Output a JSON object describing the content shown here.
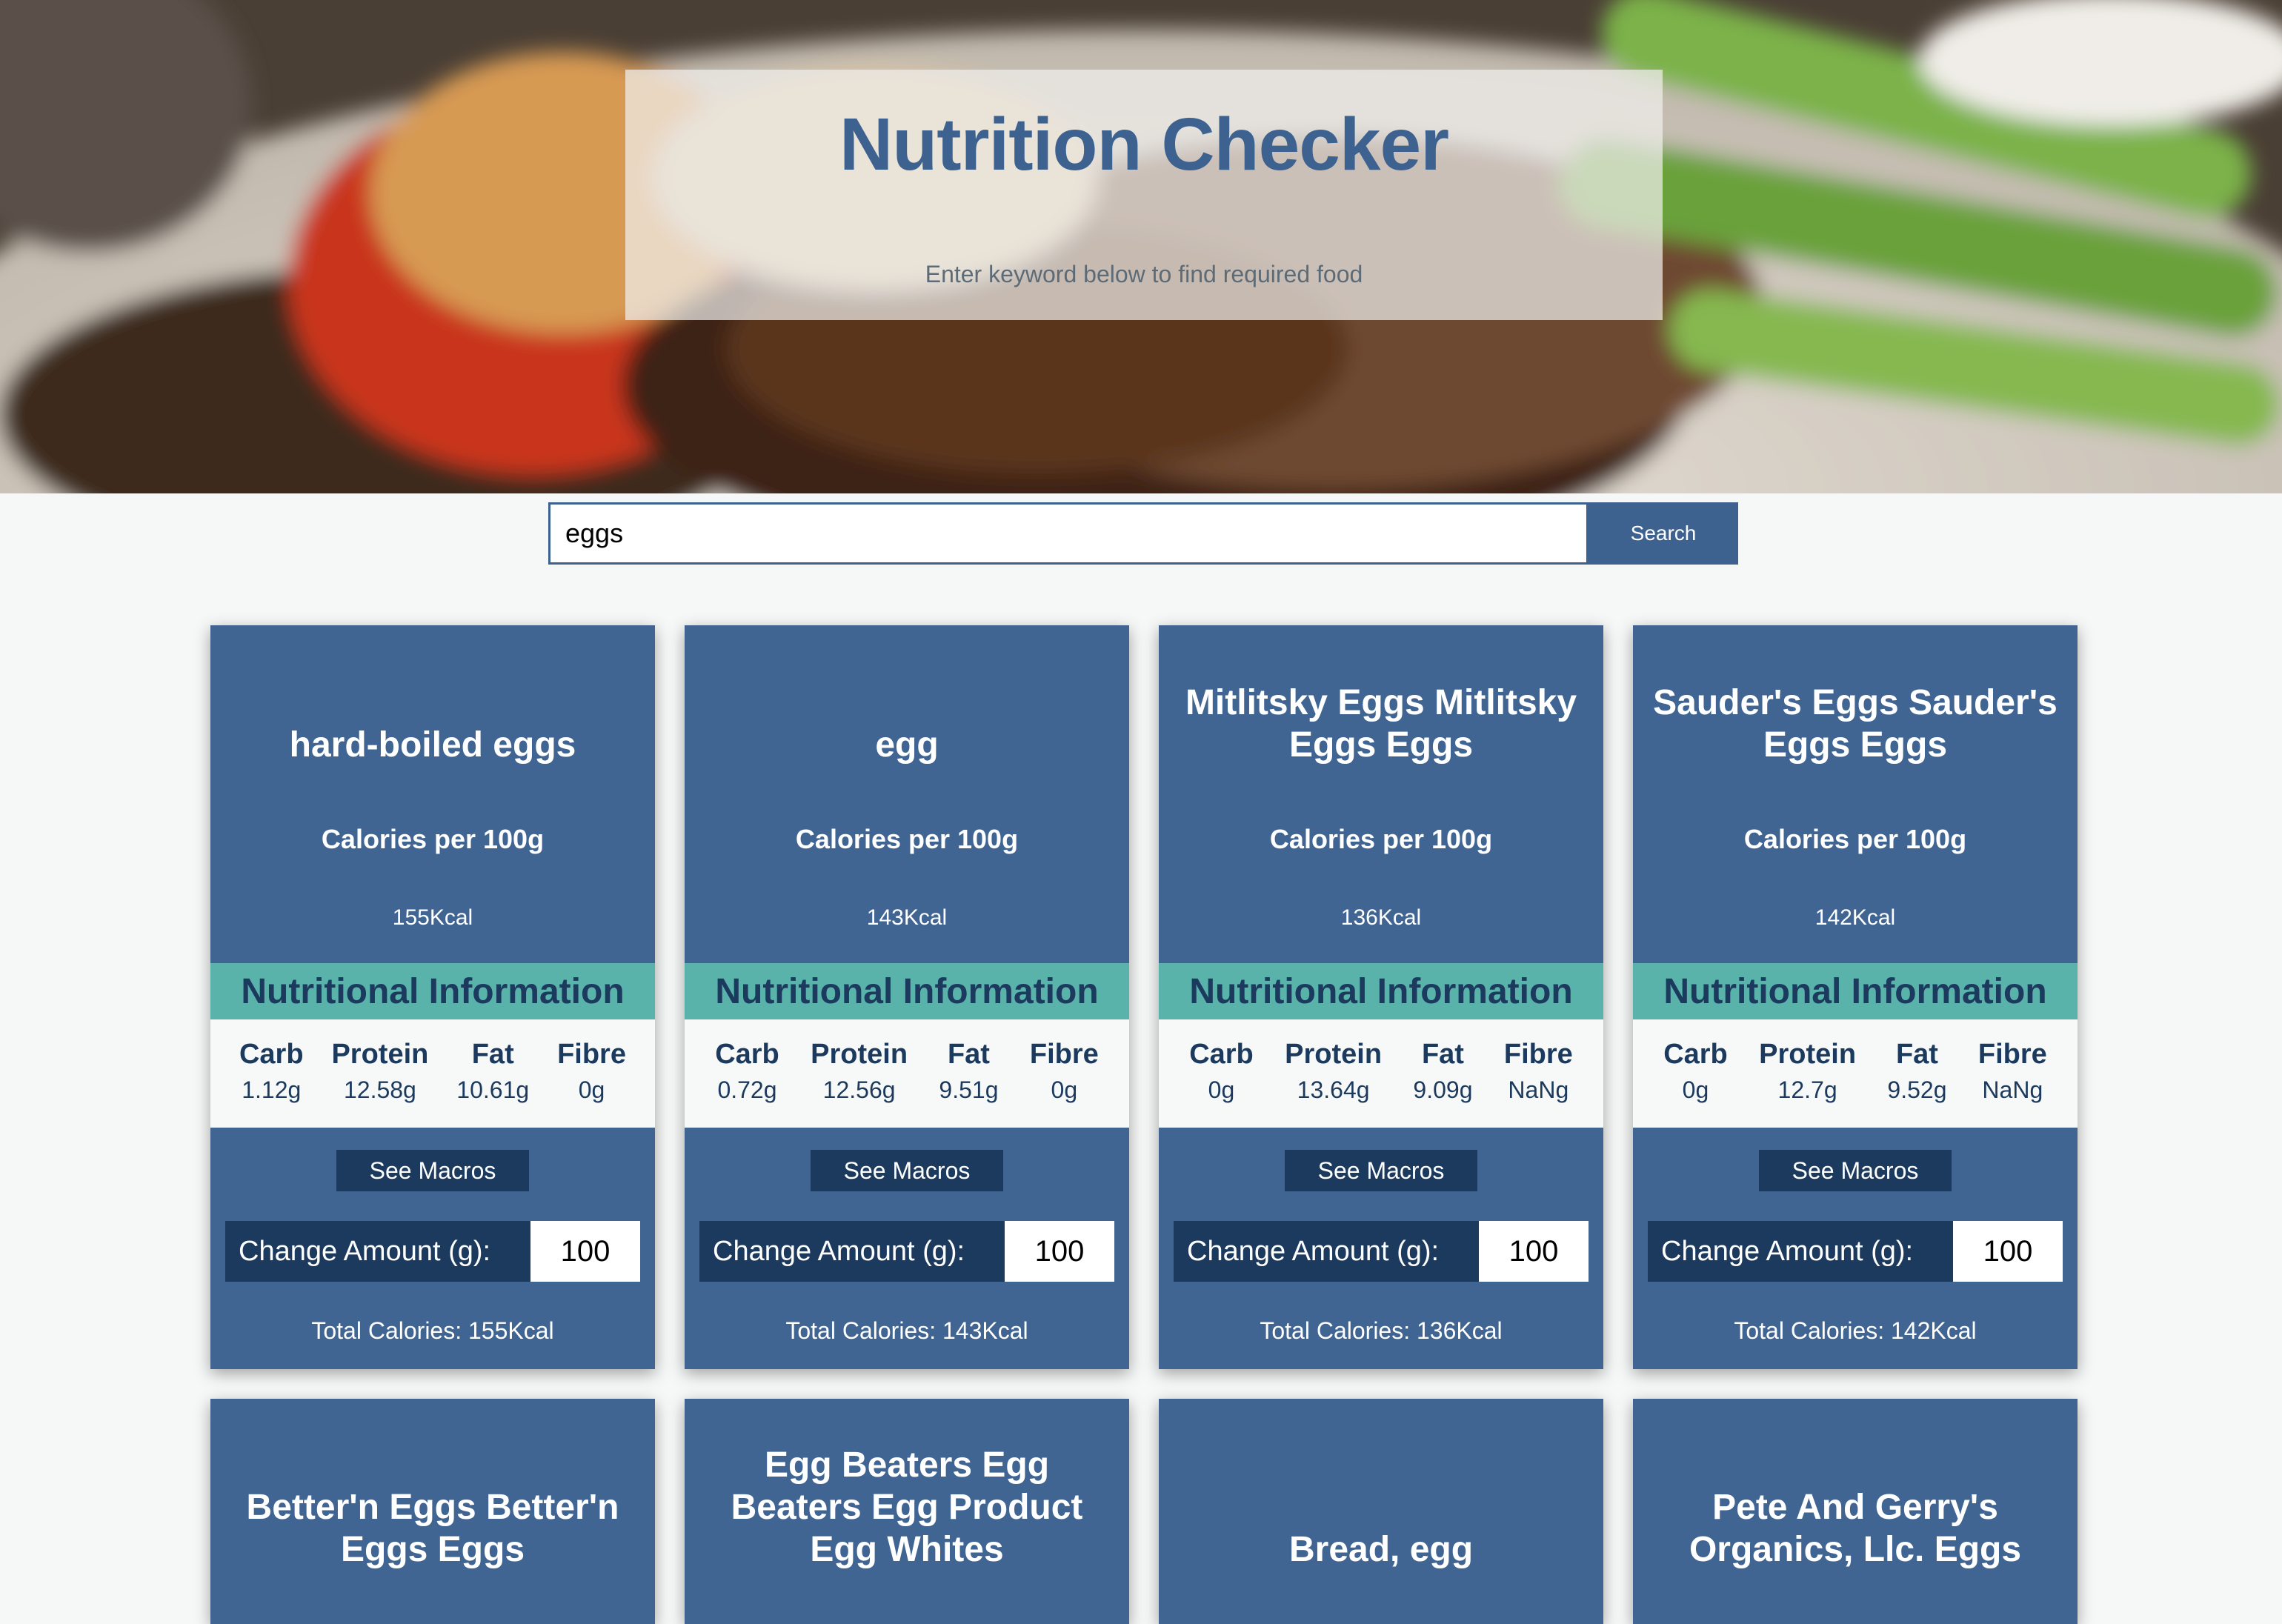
{
  "header": {
    "title": "Nutrition Checker",
    "subtitle": "Enter keyword below to find required food"
  },
  "search": {
    "value": "eggs",
    "button_label": "Search"
  },
  "labels": {
    "calories_per": "Calories per 100g",
    "nutritional_info": "Nutritional Information",
    "carb": "Carb",
    "protein": "Protein",
    "fat": "Fat",
    "fibre": "Fibre",
    "see_macros": "See Macros",
    "change_amount": "Change Amount (g):"
  },
  "cards": [
    {
      "name": "hard-boiled eggs",
      "calories": "155Kcal",
      "carb": "1.12g",
      "protein": "12.58g",
      "fat": "10.61g",
      "fibre": "0g",
      "amount": "100",
      "total": "Total Calories: 155Kcal"
    },
    {
      "name": "egg",
      "calories": "143Kcal",
      "carb": "0.72g",
      "protein": "12.56g",
      "fat": "9.51g",
      "fibre": "0g",
      "amount": "100",
      "total": "Total Calories: 143Kcal"
    },
    {
      "name": "Mitlitsky Eggs Mitlitsky Eggs Eggs",
      "calories": "136Kcal",
      "carb": "0g",
      "protein": "13.64g",
      "fat": "9.09g",
      "fibre": "NaNg",
      "amount": "100",
      "total": "Total Calories: 136Kcal"
    },
    {
      "name": "Sauder's Eggs Sauder's Eggs Eggs",
      "calories": "142Kcal",
      "carb": "0g",
      "protein": "12.7g",
      "fat": "9.52g",
      "fibre": "NaNg",
      "amount": "100",
      "total": "Total Calories: 142Kcal"
    },
    {
      "name": "Better'n Eggs Better'n Eggs Eggs"
    },
    {
      "name": "Egg Beaters Egg Beaters Egg Product Egg Whites"
    },
    {
      "name": "Bread, egg"
    },
    {
      "name": "Pete And Gerry's Organics, Llc. Eggs"
    }
  ],
  "colors": {
    "card_bg": "#406593",
    "accent_teal": "#59b3ab",
    "dark_navy": "#1c3a5e",
    "title_blue": "#3d6290"
  }
}
